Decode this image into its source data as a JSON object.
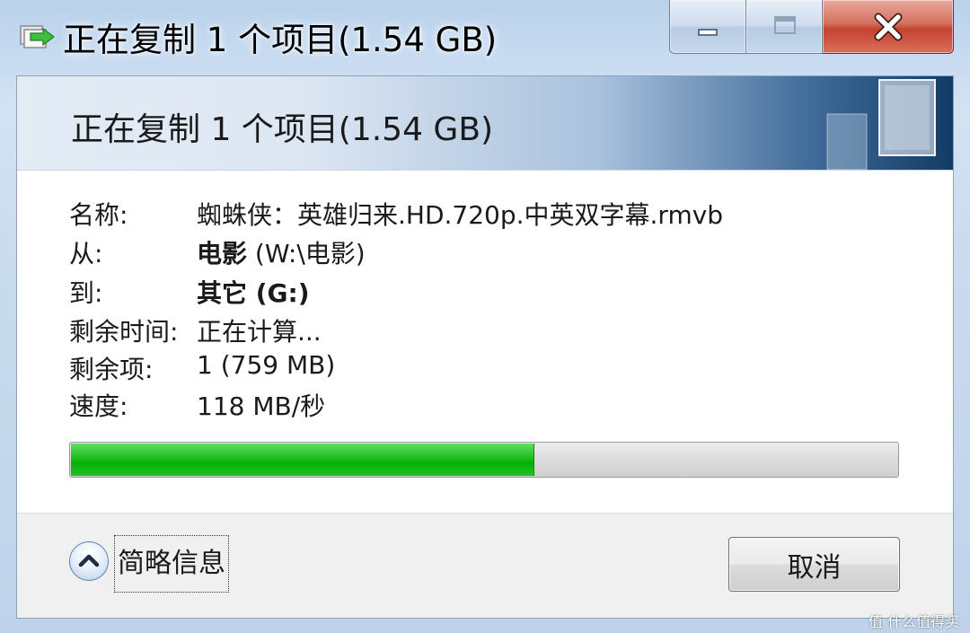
{
  "window": {
    "title": "正在复制 1 个项目(1.54 GB)"
  },
  "header": {
    "title": "正在复制 1 个项目(1.54 GB)"
  },
  "details": [
    {
      "label": "名称:",
      "value": "蜘蛛侠：英雄归来.HD.720p.中英双字幕.rmvb"
    },
    {
      "label": "从:",
      "value_bold": "电影",
      "value": " (W:\\电影)"
    },
    {
      "label": "到:",
      "value_bold": "其它 (G:)"
    },
    {
      "label": "剩余时间:",
      "value": "正在计算..."
    },
    {
      "label": "剩余项:",
      "value": "1 (759 MB)"
    },
    {
      "label": "速度:",
      "value": "118 MB/秒"
    }
  ],
  "progress": {
    "fraction": 0.56,
    "color": "#06b006"
  },
  "footer": {
    "details_toggle_label": "简略信息",
    "cancel_label": "取消"
  },
  "watermark": {
    "text": "值 什么值得买"
  },
  "icons": {
    "app": "copy-arrow-icon",
    "minimize": "minimize-icon",
    "maximize": "maximize-icon",
    "close": "close-icon",
    "toggle": "chevron-up-icon"
  }
}
